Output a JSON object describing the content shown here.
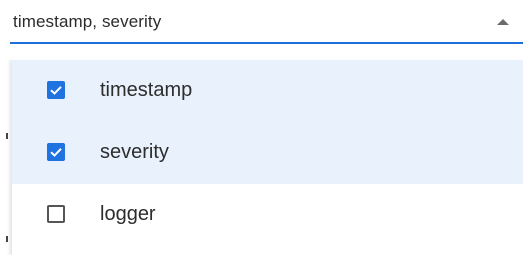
{
  "select": {
    "value": "timestamp, severity",
    "caret_icon": "caret-up-icon",
    "accent_color": "#1e6fd9"
  },
  "options": [
    {
      "label": "timestamp",
      "checked": true
    },
    {
      "label": "severity",
      "checked": true
    },
    {
      "label": "logger",
      "checked": false
    }
  ],
  "colors": {
    "selected_row_bg": "#e8f1fc",
    "checkbox_checked": "#1f73e0"
  }
}
